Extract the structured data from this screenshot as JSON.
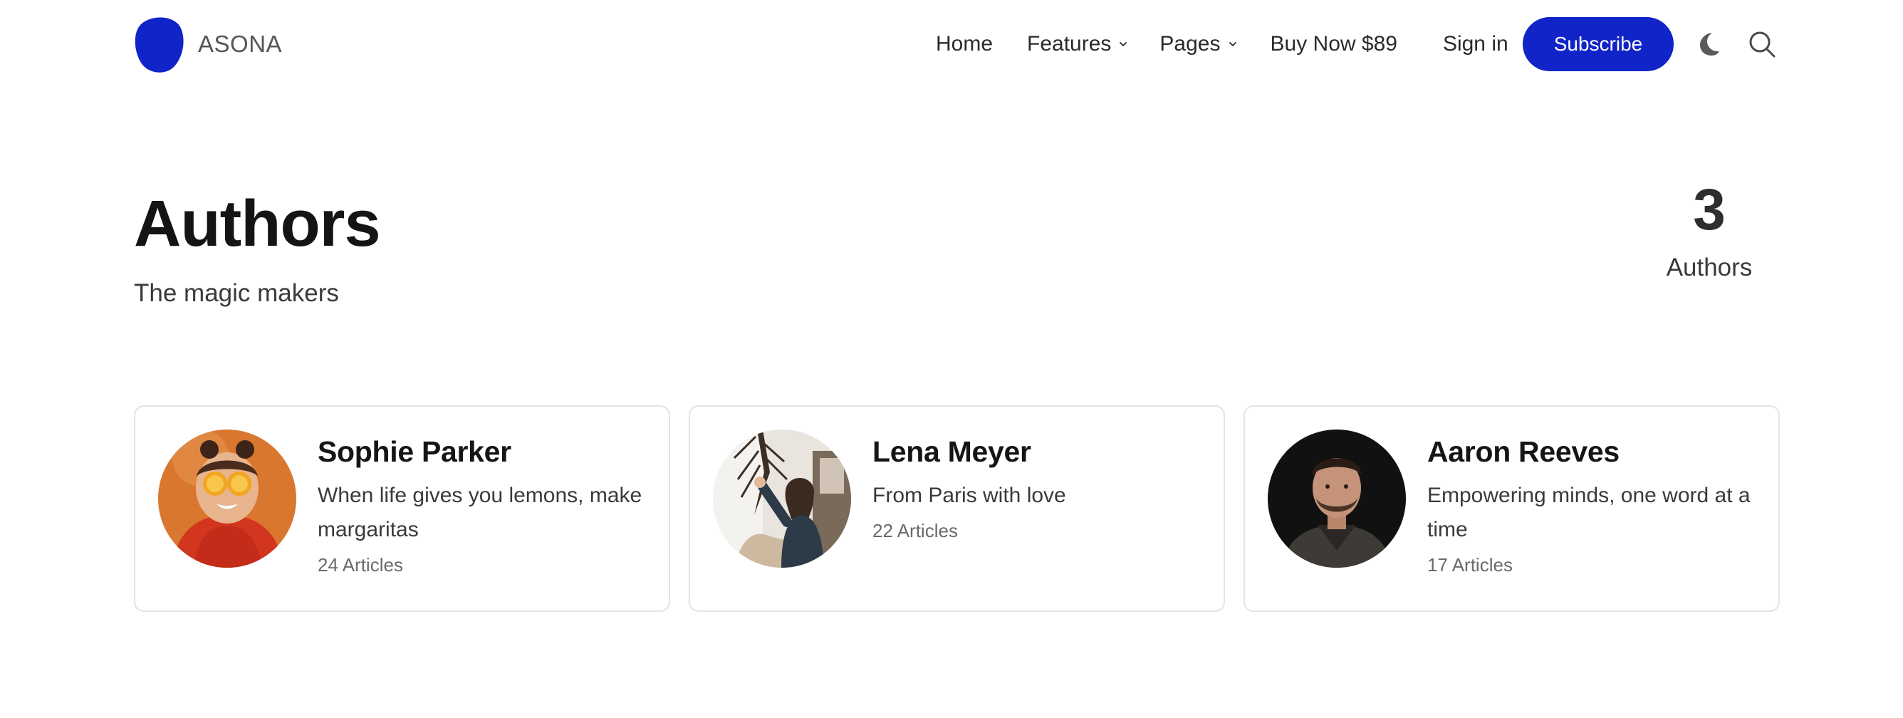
{
  "brand": {
    "name": "ASONA",
    "accent": "#1024c8"
  },
  "nav": {
    "home": "Home",
    "features": "Features",
    "pages": "Pages",
    "buy": "Buy Now $89",
    "signin": "Sign in",
    "subscribe": "Subscribe",
    "icons": [
      "chevron-down-icon",
      "moon-icon",
      "search-icon"
    ]
  },
  "hero": {
    "title": "Authors",
    "subtitle": "The magic makers",
    "count": "3",
    "count_label": "Authors"
  },
  "authors": [
    {
      "name": "Sophie Parker",
      "bio": "When life gives you lemons, make margaritas",
      "articles": "24 Articles"
    },
    {
      "name": "Lena Meyer",
      "bio": "From Paris with love",
      "articles": "22 Articles"
    },
    {
      "name": "Aaron Reeves",
      "bio": "Empowering minds, one word at a time",
      "articles": "17 Articles"
    }
  ]
}
